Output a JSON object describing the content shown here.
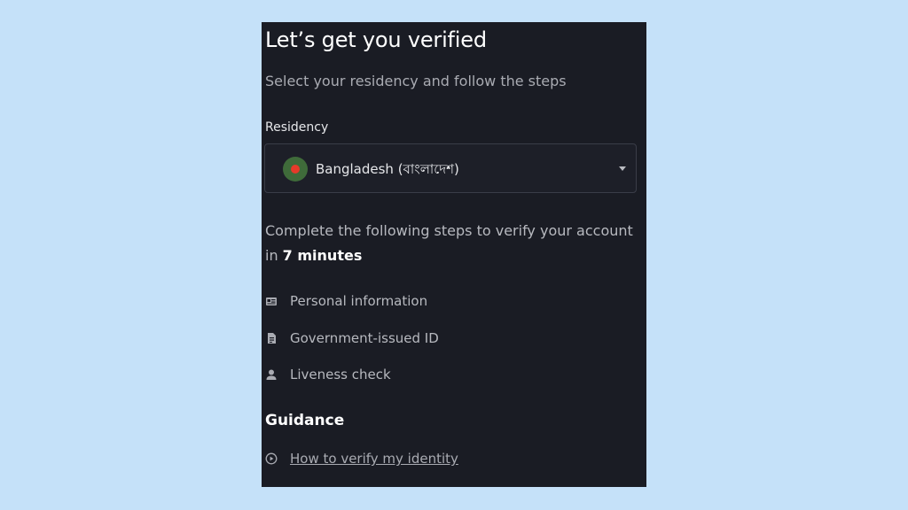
{
  "title": "Let’s get you verified",
  "subtitle": "Select your residency and follow the steps",
  "residency": {
    "label": "Residency",
    "selected": "Bangladesh (বাংলাদেশ)"
  },
  "description": {
    "prefix": "Complete the following steps to verify your account in ",
    "emphasis": "7 minutes"
  },
  "steps": [
    {
      "label": "Personal information",
      "icon": "id-card-icon"
    },
    {
      "label": "Government-issued ID",
      "icon": "document-icon"
    },
    {
      "label": "Liveness check",
      "icon": "person-icon"
    }
  ],
  "guidance": {
    "heading": "Guidance",
    "link_label": "How to verify my identity",
    "link_icon": "play-circle-icon"
  },
  "colors": {
    "page_background": "#c5e1f9",
    "panel_background": "#1a1c24",
    "flag_green": "#3f6b3a",
    "flag_red": "#e63a2a"
  }
}
